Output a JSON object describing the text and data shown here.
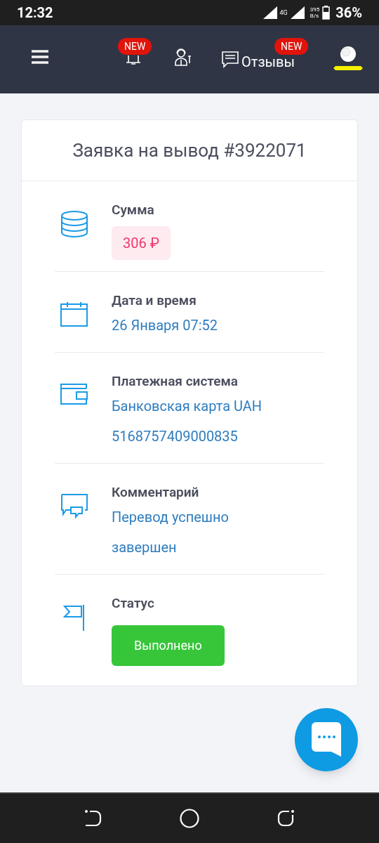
{
  "status_bar": {
    "time": "12:32",
    "network": "4G",
    "speed": "395",
    "speed_unit": "B/s",
    "battery": "36%"
  },
  "nav": {
    "bell_badge": "NEW",
    "reviews_label": "Отзывы",
    "reviews_badge": "NEW"
  },
  "card": {
    "title": "Заявка на вывод #3922071",
    "rows": [
      {
        "kind": "amount",
        "label": "Сумма",
        "values": [
          "306 ₽"
        ]
      },
      {
        "kind": "text",
        "label": "Дата и время",
        "values": [
          "26 Января 07:52"
        ]
      },
      {
        "kind": "text",
        "label": "Платежная система",
        "values": [
          "Банковская карта UAH",
          "5168757409000835"
        ]
      },
      {
        "kind": "text",
        "label": "Комментарий",
        "values": [
          "Перевод успешно завершен"
        ]
      },
      {
        "kind": "status",
        "label": "Статус",
        "values": [
          "Выполнено"
        ]
      }
    ]
  }
}
